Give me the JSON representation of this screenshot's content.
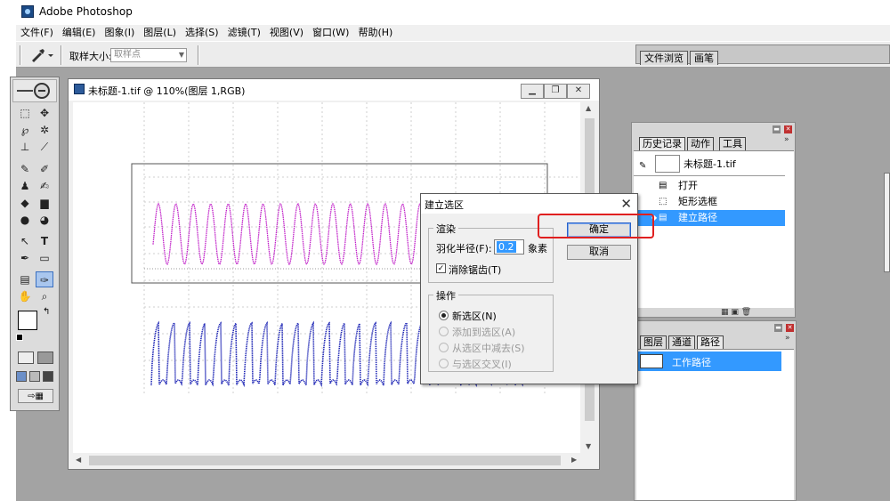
{
  "app": {
    "title": "Adobe Photoshop",
    "leftapp_letter": "P"
  },
  "menu": [
    "文件(F)",
    "编辑(E)",
    "图象(I)",
    "图层(L)",
    "选择(S)",
    "滤镜(T)",
    "视图(V)",
    "窗口(W)",
    "帮助(H)"
  ],
  "options": {
    "sample_size_label": "取样大小:",
    "sample_size_value": "取样点"
  },
  "palette_well": {
    "tabs": [
      "文件浏览",
      "画笔"
    ]
  },
  "document": {
    "title": "未标题-1.tif @ 110%(图层 1,RGB)"
  },
  "history_panel": {
    "tabs": [
      "历史记录",
      "动作",
      "工具"
    ],
    "snapshot": "未标题-1.tif",
    "items": [
      {
        "label": "打开",
        "selected": false
      },
      {
        "label": "矩形选框",
        "selected": false
      },
      {
        "label": "建立路径",
        "selected": true
      }
    ]
  },
  "paths_panel": {
    "tabs": [
      "图层",
      "通道",
      "路径"
    ],
    "work_path": "工作路径"
  },
  "dialog": {
    "title": "建立选区",
    "render_group": "渲染",
    "feather_label": "羽化半径(F):",
    "feather_value": "0.2",
    "feather_unit": "象素",
    "antialias_label": "消除锯齿(T)",
    "antialias_checked": true,
    "operation_group": "操作",
    "operations": [
      {
        "label": "新选区(N)",
        "selected": true,
        "enabled": true
      },
      {
        "label": "添加到选区(A)",
        "selected": false,
        "enabled": false
      },
      {
        "label": "从选区中减去(S)",
        "selected": false,
        "enabled": false
      },
      {
        "label": "与选区交叉(I)",
        "selected": false,
        "enabled": false
      }
    ],
    "ok_label": "确定",
    "cancel_label": "取消"
  },
  "colors": {
    "purple_wave": "#c020c8",
    "blue_wave": "#1a22b4",
    "highlight": "#e02020",
    "selection": "#3399ff"
  }
}
